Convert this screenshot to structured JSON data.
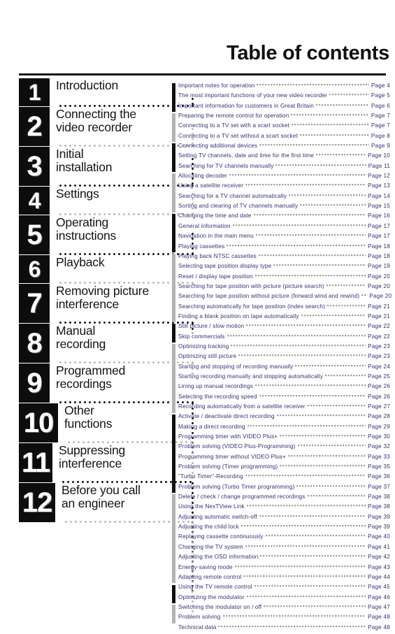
{
  "header": {
    "title": "Table of contents"
  },
  "colors": {
    "entry_text": "#30307a",
    "chapter_box_bg": "#0d0d0d",
    "chapter_label": "#141414",
    "rule": "#111111",
    "bar_dark": "#111111",
    "bar_light": "#b3b3b3",
    "leader_dots": "#9a9a9a"
  },
  "chapters": [
    {
      "number": "1",
      "label": "Introduction",
      "bar": "dark",
      "entry_count": 3
    },
    {
      "number": "2",
      "label": "Connecting the\nvideo recorder",
      "bar": "light",
      "entry_count": 3
    },
    {
      "number": "3",
      "label": "Initial\ninstallation",
      "bar": "dark",
      "entry_count": 3
    },
    {
      "number": "4",
      "label": "Settings",
      "bar": "light",
      "entry_count": 4
    },
    {
      "number": "5",
      "label": "Operating\ninstructions",
      "bar": "dark",
      "entry_count": 4
    },
    {
      "number": "6",
      "label": "Playback",
      "bar": "light",
      "entry_count": 7
    },
    {
      "number": "7",
      "label": "Removing picture\ninterference",
      "bar": "dark",
      "entry_count": 2
    },
    {
      "number": "8",
      "label": "Manual\nrecording",
      "bar": "light",
      "entry_count": 7
    },
    {
      "number": "9",
      "label": "Programmed\nrecordings",
      "bar": "dark",
      "entry_count": 8
    },
    {
      "number": "10",
      "label": "Other\nfunctions",
      "bar": "light",
      "entry_count": 9
    },
    {
      "number": "11",
      "label": "Suppressing\ninterference",
      "bar": "dark",
      "entry_count": 2
    },
    {
      "number": "12",
      "label": "Before you call\nan engineer",
      "bar": "light",
      "entry_count": 2
    }
  ],
  "entries": [
    {
      "title": "Important notes for operation",
      "page": "Page 4"
    },
    {
      "title": "The most important functions of your new video recorder",
      "page": "Page 5"
    },
    {
      "title": "Important information for customers in Great Britain",
      "page": "Page 6"
    },
    {
      "title": "Preparing the remote control for operation",
      "page": "Page 7"
    },
    {
      "title": "Connecting to a TV set with a scart socket",
      "page": "Page 7"
    },
    {
      "title": "Connecting to a TV set without a scart socket",
      "page": "Page 8"
    },
    {
      "title": "Connecting additional devices",
      "page": "Page 9"
    },
    {
      "title": "Setting TV channels, date and time for the  first time",
      "page": "Page 10"
    },
    {
      "title": "Searching for TV channels manually",
      "page": "Page 11"
    },
    {
      "title": "Allocating decoder",
      "page": "Page 12"
    },
    {
      "title": "Using a satellite receiver",
      "page": "Page 13"
    },
    {
      "title": "Searching for a TV channel automatically",
      "page": "Page 14"
    },
    {
      "title": "Sorting and clearing of TV channels manually",
      "page": "Page 15"
    },
    {
      "title": "Changing the time and  date",
      "page": "Page 16"
    },
    {
      "title": "General information",
      "page": "Page 17"
    },
    {
      "title": "Navigation in the main menu",
      "page": "Page 17"
    },
    {
      "title": "Playing cassettes",
      "page": "Page 18"
    },
    {
      "title": "Playing back NTSC cassettes",
      "page": "Page 18"
    },
    {
      "title": "Selecting tape position display type",
      "page": "Page 19"
    },
    {
      "title": "Reset / display tape position",
      "page": "Page 20"
    },
    {
      "title": "Searching for tape position with picture (picture search)",
      "page": "Page 20"
    },
    {
      "title": "Searching for tape position without picture (forward wind and rewind)",
      "page": "Page 20"
    },
    {
      "title": "Searching automatically for tape position (index search)",
      "page": "Page 21"
    },
    {
      "title": "Finding a blank position on tape automatically",
      "page": "Page 21"
    },
    {
      "title": "Still picture / slow motion",
      "page": "Page 22"
    },
    {
      "title": "Skip commercials",
      "page": "Page 22"
    },
    {
      "title": "Optimizing tracking",
      "page": "Page 23"
    },
    {
      "title": "Optimizing still picture",
      "page": "Page 23"
    },
    {
      "title": "Starting and stopping of recording manually",
      "page": "Page 24"
    },
    {
      "title": "Starting recording manually and stopping automatically",
      "page": "Page 25"
    },
    {
      "title": "Lining up manual recordings",
      "page": "Page 26"
    },
    {
      "title": "Selecting the recording speed",
      "page": "Page 26"
    },
    {
      "title": "Recording automatically from a satellite receiver",
      "page": "Page 27"
    },
    {
      "title": "Activate /  deactivate direct recording",
      "page": "Page 28"
    },
    {
      "title": "Making a direct recording",
      "page": "Page 29"
    },
    {
      "title": "Programming timer with VIDEO Plus+",
      "page": "Page 30"
    },
    {
      "title": "Problem solving (VIDEO Plus-Programming)",
      "page": "Page 32"
    },
    {
      "title": "Programming timer without VIDEO Plus+",
      "page": "Page 33"
    },
    {
      "title": "Problem solving (Timer programming)",
      "page": "Page 35"
    },
    {
      "title": "“Turbo Timer”-Recording",
      "page": "Page 36"
    },
    {
      "title": "Problem solving (Turbo Timer programming)",
      "page": "Page 37"
    },
    {
      "title": "Delete / check / change programmed recordings",
      "page": "Page 38"
    },
    {
      "title": "Using the NexTView Link",
      "page": "Page 38"
    },
    {
      "title": "Adjusting automatic switch-off",
      "page": "Page 39"
    },
    {
      "title": "Adjusting the child lock",
      "page": "Page 39"
    },
    {
      "title": "Replaying cassette continuously",
      "page": "Page 40"
    },
    {
      "title": "Changing the TV system",
      "page": "Page 41"
    },
    {
      "title": "Adjusting the OSD information",
      "page": "Page 42"
    },
    {
      "title": "Energy-saving mode",
      "page": "Page 43"
    },
    {
      "title": "Adapting remote control",
      "page": "Page 44"
    },
    {
      "title": "Using the TV remote control",
      "page": "Page 45"
    },
    {
      "title": "Optimizing the modulator",
      "page": "Page 46"
    },
    {
      "title": "Switching the modulator on / off",
      "page": "Page 47"
    },
    {
      "title": "Problem solving",
      "page": "Page 48"
    },
    {
      "title": "Technical data",
      "page": "Page 48"
    }
  ]
}
